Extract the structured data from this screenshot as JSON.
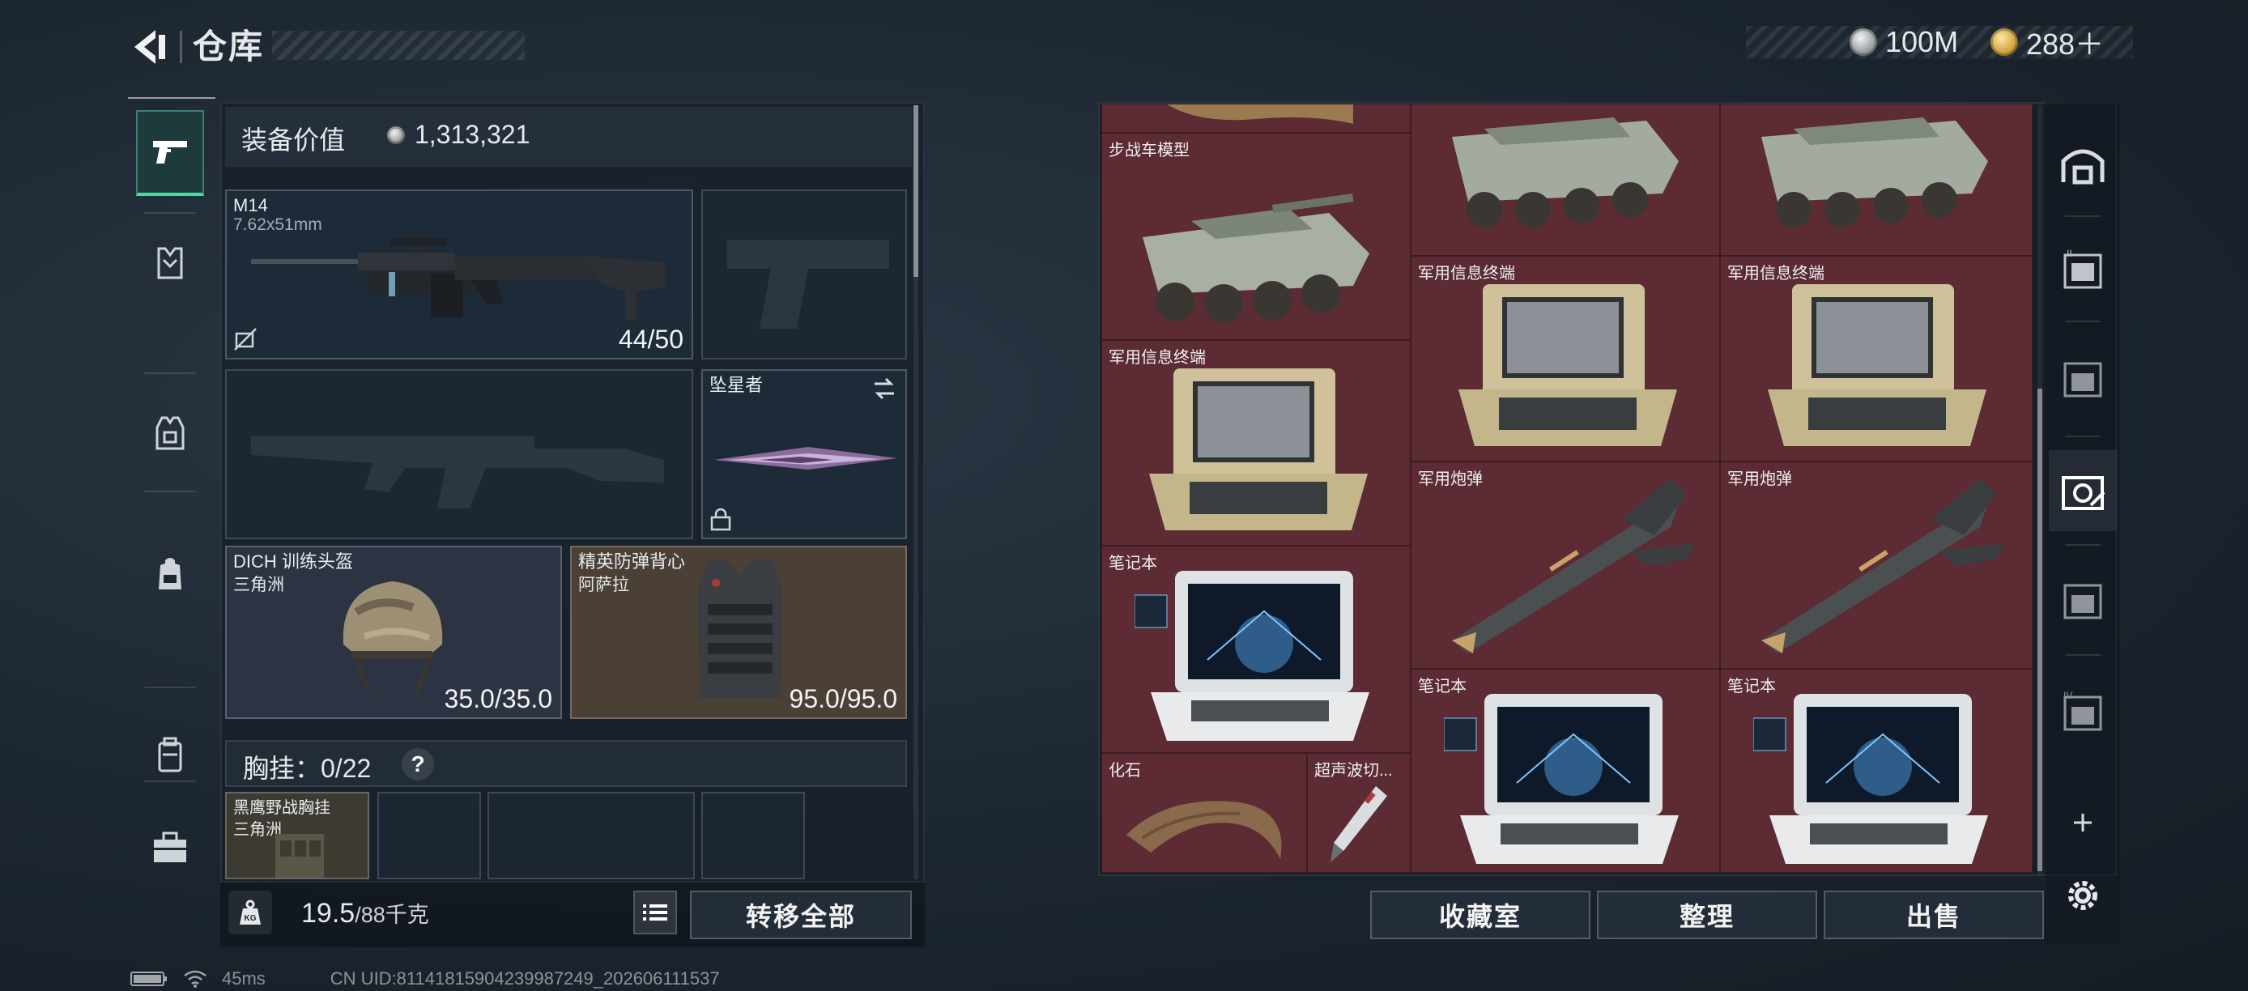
{
  "header": {
    "title": "仓库",
    "currencies": [
      {
        "name": "silver-coin",
        "amount": "100M",
        "color": "#c9cdd1"
      },
      {
        "name": "gold-coin",
        "amount": "288＋",
        "color": "#d8a33a"
      }
    ]
  },
  "left_nav": {
    "items": [
      {
        "icon": "pistol-icon",
        "active": true
      },
      {
        "icon": "helmet-armor-icon",
        "active": false
      },
      {
        "icon": "vest-icon",
        "active": false
      },
      {
        "icon": "backpack-icon",
        "active": false
      },
      {
        "icon": "pouch-icon",
        "active": false
      },
      {
        "icon": "briefcase-icon",
        "active": false
      }
    ]
  },
  "equipment": {
    "value_label": "装备价值",
    "value_amount": "1,313,321",
    "primary_weapon": {
      "name": "M14",
      "caliber": "7.62x51mm",
      "ammo": "44/50"
    },
    "secondary_weapon": {
      "name": "坠星者"
    },
    "helmet": {
      "name": "DICH 训练头盔",
      "origin": "三角洲",
      "durability": "35.0/35.0"
    },
    "armor": {
      "name": "精英防弹背心",
      "origin": "阿萨拉",
      "durability": "95.0/95.0"
    },
    "chest_rig": {
      "label": "胸挂：0/22",
      "help": "?"
    },
    "chest_rig_item": {
      "name": "黑鹰野战胸挂",
      "origin": "三角洲"
    }
  },
  "bottom_bar": {
    "weight_current": "19.5",
    "weight_capacity": "/88千克",
    "transfer_all": "转移全部"
  },
  "storage": {
    "items": [
      {
        "name": "步战车模型"
      },
      {
        "name": "军用信息终端"
      },
      {
        "name": "军用信息终端"
      },
      {
        "name": "军用信息终端"
      },
      {
        "name": "军用炮弹"
      },
      {
        "name": "军用炮弹"
      },
      {
        "name": "笔记本"
      },
      {
        "name": "笔记本"
      },
      {
        "name": "笔记本"
      },
      {
        "name": "化石"
      },
      {
        "name": "超声波切..."
      }
    ],
    "buttons": {
      "collection": "收藏室",
      "sort": "整理",
      "sell": "出售"
    }
  },
  "right_tabs": {
    "items": [
      {
        "icon": "storage-home-icon"
      },
      {
        "icon": "storage-page-2-icon"
      },
      {
        "icon": "storage-page-3-icon"
      },
      {
        "icon": "storage-page-active-icon"
      },
      {
        "icon": "storage-page-5-icon"
      },
      {
        "icon": "storage-page-6-icon"
      },
      {
        "icon": "add-icon"
      },
      {
        "icon": "settings-gear-icon"
      }
    ]
  },
  "footer": {
    "ping": "45ms",
    "uid": "CN UID:81141815904239987249_202606111537"
  },
  "colors": {
    "grid_bg": "#5c2b33",
    "accent_green": "#4fd8a5",
    "panel_bg": "#18202a"
  }
}
